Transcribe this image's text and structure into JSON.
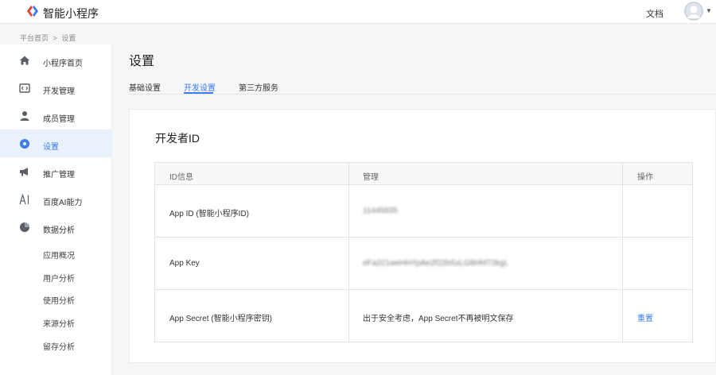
{
  "header": {
    "brand": "智能小程序",
    "docs_label": "文档",
    "brand_color": "#3b7cf0"
  },
  "breadcrumb": {
    "home": "平台首页",
    "separator": ">",
    "current": "设置"
  },
  "sidebar": {
    "items": [
      {
        "label": "小程序首页",
        "icon": "home-icon"
      },
      {
        "label": "开发管理",
        "icon": "code-icon"
      },
      {
        "label": "成员管理",
        "icon": "user-icon"
      },
      {
        "label": "设置",
        "icon": "settings-icon",
        "active": true
      },
      {
        "label": "推广管理",
        "icon": "megaphone-icon"
      },
      {
        "label": "百度AI能力",
        "icon": "ai-icon"
      },
      {
        "label": "数据分析",
        "icon": "pie-chart-icon"
      }
    ],
    "sub_items": [
      "应用概况",
      "用户分析",
      "使用分析",
      "来源分析",
      "留存分析"
    ]
  },
  "main": {
    "title": "设置",
    "tabs": [
      {
        "label": "基础设置"
      },
      {
        "label": "开发设置",
        "active": true
      },
      {
        "label": "第三方服务"
      }
    ]
  },
  "developer_id": {
    "title": "开发者ID",
    "columns": [
      "ID信息",
      "管理",
      "操作"
    ],
    "rows": [
      {
        "name": "App ID (智能小程序ID)",
        "value": "11445835",
        "action": ""
      },
      {
        "name": "App Key",
        "value": "eFa221weHHYpAe2f22bSxLG8Hhf72kgL",
        "action": ""
      },
      {
        "name": "App Secret (智能小程序密钥)",
        "value": "出于安全考虑，App Secret不再被明文保存",
        "action": "重置"
      }
    ]
  }
}
